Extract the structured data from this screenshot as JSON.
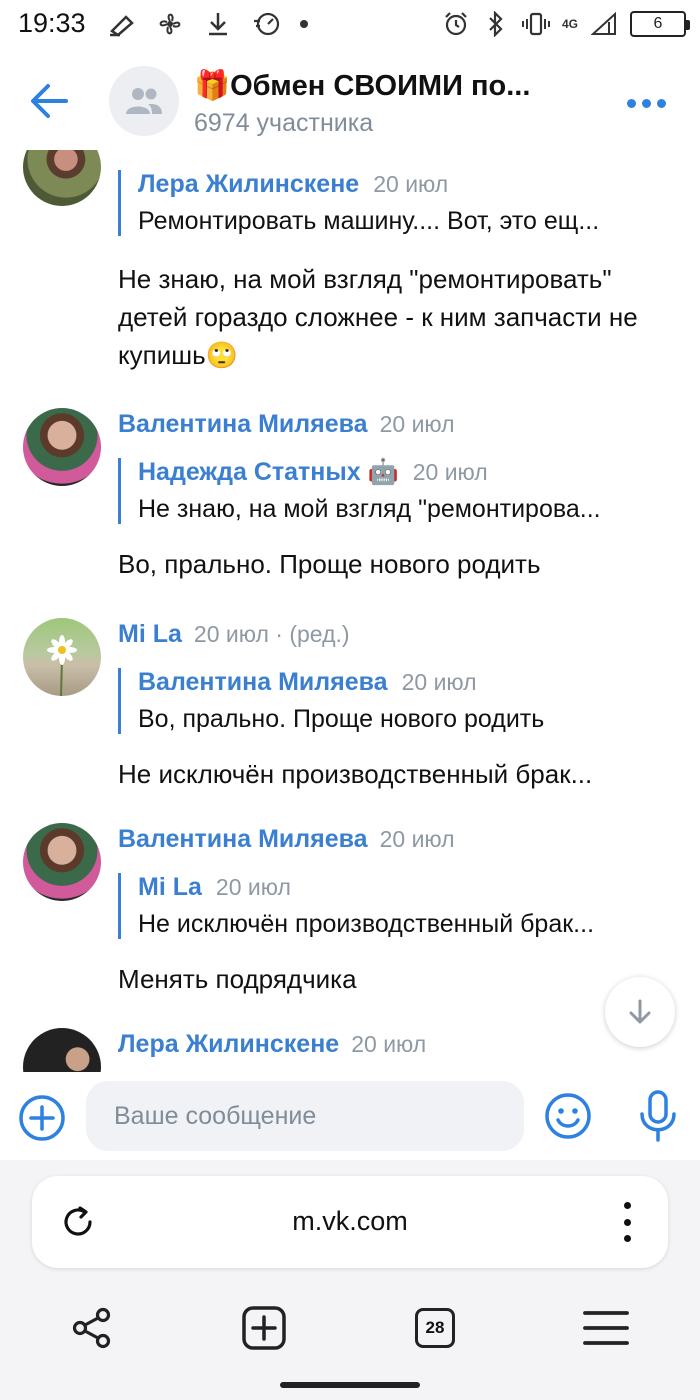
{
  "status_bar": {
    "time": "19:33",
    "network": "4G",
    "battery": "6"
  },
  "header": {
    "title": "🎁Обмен СВОИМИ по...",
    "subtitle": "6974 участника",
    "accent_color": "#2d81e0"
  },
  "messages": [
    {
      "quote": {
        "author": "Лера Жилинскене",
        "date": "20 июл",
        "text": "Ремонтировать машину.... Вот, это ещ..."
      },
      "text": "Не знаю, на мой взгляд \"ремонтировать\" детей гораздо сложнее - к ним запчасти не купишь🙄"
    },
    {
      "author": "Валентина Миляева",
      "date": "20 июл",
      "quote": {
        "author": "Надежда Статных 🤖",
        "date": "20 июл",
        "text": "Не знаю, на мой взгляд \"ремонтирова..."
      },
      "text": "Во, прально. Проще нового родить"
    },
    {
      "author": "Mi La",
      "date": "20 июл · (ред.)",
      "quote": {
        "author": "Валентина Миляева",
        "date": "20 июл",
        "text": "Во, прально. Проще нового родить"
      },
      "text": "Не исключён производственный брак..."
    },
    {
      "author": "Валентина Миляева",
      "date": "20 июл",
      "quote": {
        "author": "Mi La",
        "date": "20 июл",
        "text": "Не исключён производственный брак..."
      },
      "text": "Менять подрядчика"
    },
    {
      "author": "Лера Жилинскене",
      "date": "20 июл"
    }
  ],
  "composer": {
    "placeholder": "Ваше сообщение"
  },
  "browser": {
    "url": "m.vk.com",
    "tabs_count": "28"
  }
}
